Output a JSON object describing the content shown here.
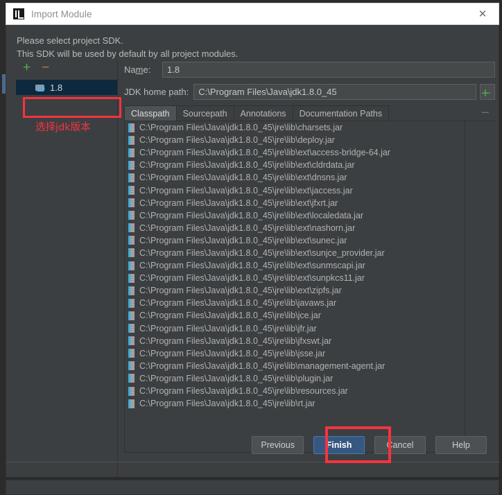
{
  "window": {
    "title": "Import Module",
    "icon": "intellij-idea-icon",
    "close_label": "✕"
  },
  "prompt": {
    "line1": "Please select project SDK.",
    "line2": "This SDK will be used by default by all project modules."
  },
  "sdk_panel": {
    "add_label": "+",
    "remove_label": "−",
    "items": [
      {
        "label": "1.8",
        "icon": "folder-icon",
        "selected": true
      }
    ]
  },
  "annotations": {
    "sdk_note": "选择jdk版本",
    "highlight_color": "#f5333f"
  },
  "detail": {
    "name_label_pre": "Na",
    "name_label_mid": "m",
    "name_label_post": "e:",
    "name_value": "1.8",
    "jdk_home_label": "JDK home path:",
    "jdk_home_value": "C:\\Program Files\\Java\\jdk1.8.0_45",
    "browse_label": "…",
    "tabs": [
      {
        "label": "Classpath",
        "active": true
      },
      {
        "label": "Sourcepath",
        "active": false
      },
      {
        "label": "Annotations",
        "active": false
      },
      {
        "label": "Documentation Paths",
        "active": false
      }
    ],
    "classpath_add_label": "+",
    "classpath_remove_label": "−",
    "classpath": [
      "C:\\Program Files\\Java\\jdk1.8.0_45\\jre\\lib\\charsets.jar",
      "C:\\Program Files\\Java\\jdk1.8.0_45\\jre\\lib\\deploy.jar",
      "C:\\Program Files\\Java\\jdk1.8.0_45\\jre\\lib\\ext\\access-bridge-64.jar",
      "C:\\Program Files\\Java\\jdk1.8.0_45\\jre\\lib\\ext\\cldrdata.jar",
      "C:\\Program Files\\Java\\jdk1.8.0_45\\jre\\lib\\ext\\dnsns.jar",
      "C:\\Program Files\\Java\\jdk1.8.0_45\\jre\\lib\\ext\\jaccess.jar",
      "C:\\Program Files\\Java\\jdk1.8.0_45\\jre\\lib\\ext\\jfxrt.jar",
      "C:\\Program Files\\Java\\jdk1.8.0_45\\jre\\lib\\ext\\localedata.jar",
      "C:\\Program Files\\Java\\jdk1.8.0_45\\jre\\lib\\ext\\nashorn.jar",
      "C:\\Program Files\\Java\\jdk1.8.0_45\\jre\\lib\\ext\\sunec.jar",
      "C:\\Program Files\\Java\\jdk1.8.0_45\\jre\\lib\\ext\\sunjce_provider.jar",
      "C:\\Program Files\\Java\\jdk1.8.0_45\\jre\\lib\\ext\\sunmscapi.jar",
      "C:\\Program Files\\Java\\jdk1.8.0_45\\jre\\lib\\ext\\sunpkcs11.jar",
      "C:\\Program Files\\Java\\jdk1.8.0_45\\jre\\lib\\ext\\zipfs.jar",
      "C:\\Program Files\\Java\\jdk1.8.0_45\\jre\\lib\\javaws.jar",
      "C:\\Program Files\\Java\\jdk1.8.0_45\\jre\\lib\\jce.jar",
      "C:\\Program Files\\Java\\jdk1.8.0_45\\jre\\lib\\jfr.jar",
      "C:\\Program Files\\Java\\jdk1.8.0_45\\jre\\lib\\jfxswt.jar",
      "C:\\Program Files\\Java\\jdk1.8.0_45\\jre\\lib\\jsse.jar",
      "C:\\Program Files\\Java\\jdk1.8.0_45\\jre\\lib\\management-agent.jar",
      "C:\\Program Files\\Java\\jdk1.8.0_45\\jre\\lib\\plugin.jar",
      "C:\\Program Files\\Java\\jdk1.8.0_45\\jre\\lib\\resources.jar",
      "C:\\Program Files\\Java\\jdk1.8.0_45\\jre\\lib\\rt.jar"
    ]
  },
  "buttons": {
    "previous": "Previous",
    "finish": "Finish",
    "cancel": "Cancel",
    "help": "Help"
  }
}
